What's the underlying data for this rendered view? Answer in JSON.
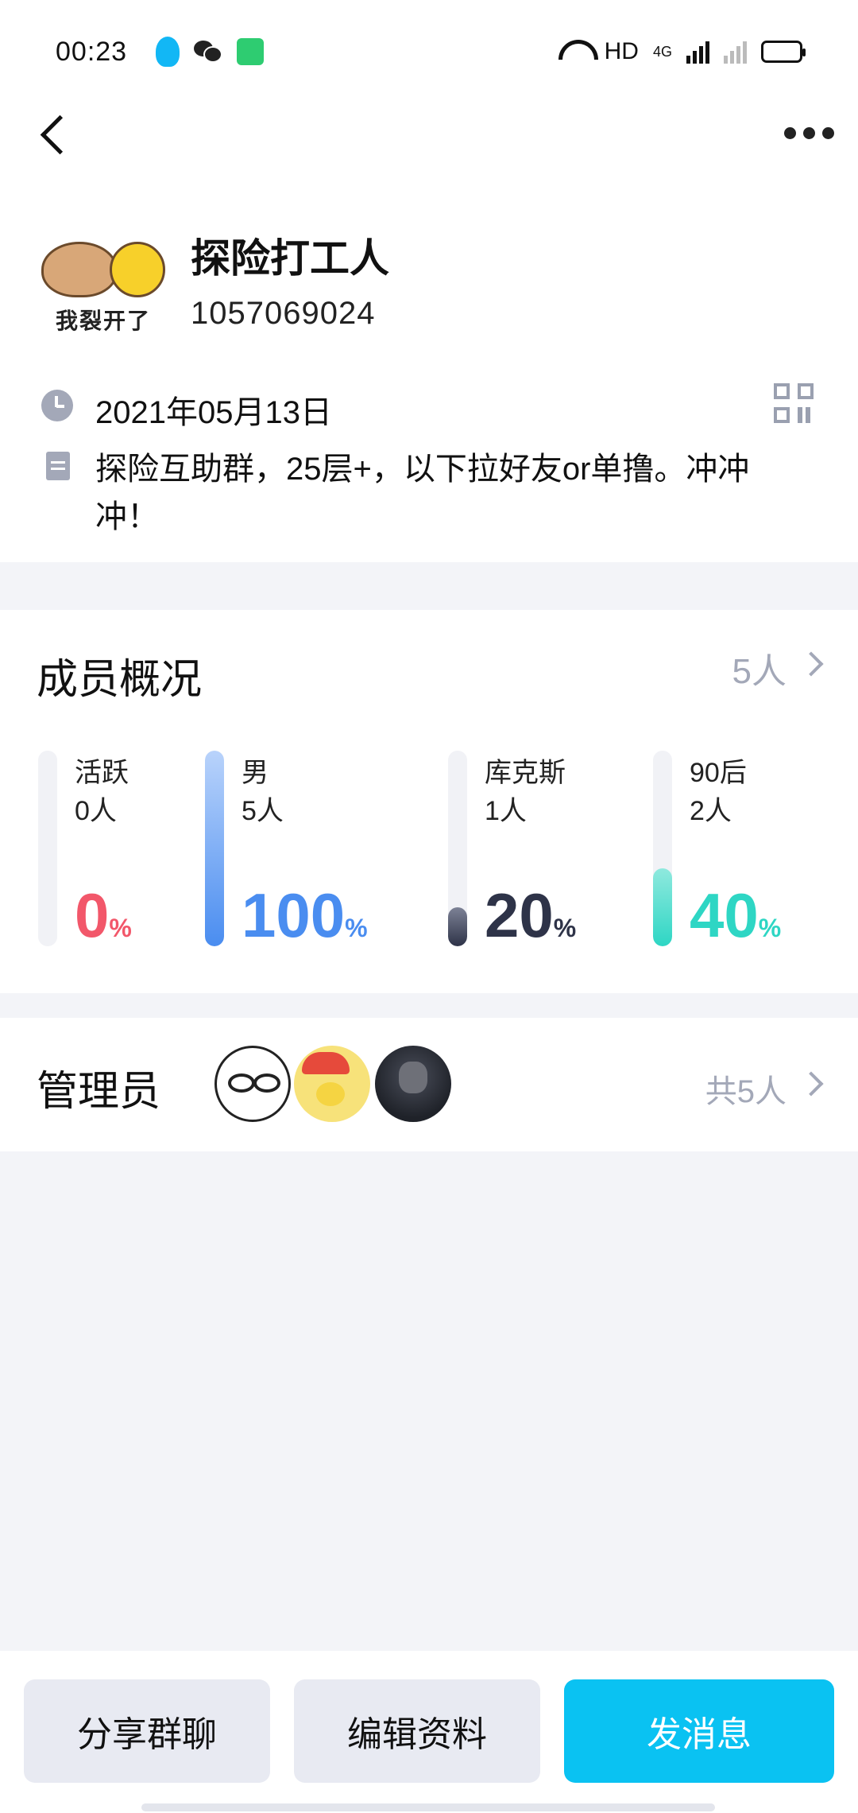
{
  "status_bar": {
    "time": "00:23",
    "network_label": "HD",
    "signal_label": "4G",
    "battery_color": "#f5c518",
    "icons": [
      "qq-icon",
      "wechat-icon",
      "battery-saver-icon",
      "wifi-icon",
      "signal-icon",
      "battery-icon"
    ]
  },
  "nav": {
    "back_icon": "chevron-left-icon",
    "more_icon": "more-horizontal-icon"
  },
  "group": {
    "avatar_caption": "我裂开了",
    "name": "探险打工人",
    "id": "1057069024",
    "created_date": "2021年05月13日",
    "description": "探险互助群，25层+，以下拉好友or单撸。冲冲冲！"
  },
  "members": {
    "title": "成员概况",
    "count": "5人",
    "stats": [
      {
        "label": "活跃",
        "people": "0人",
        "percent_value": "0",
        "percent_sign": "%",
        "fraction": 0.0,
        "color": "#f2576a"
      },
      {
        "label": "男",
        "people": "5人",
        "percent_value": "100",
        "percent_sign": "%",
        "fraction": 1.0,
        "color": "#4a8df0"
      },
      {
        "label": "库克斯",
        "people": "1人",
        "percent_value": "20",
        "percent_sign": "%",
        "fraction": 0.2,
        "color": "#2e3348"
      },
      {
        "label": "90后",
        "people": "2人",
        "percent_value": "40",
        "percent_sign": "%",
        "fraction": 0.4,
        "color": "#2ed6c4"
      }
    ]
  },
  "admins": {
    "title": "管理员",
    "count": "共5人"
  },
  "bottom_bar": {
    "share_label": "分享群聊",
    "edit_label": "编辑资料",
    "send_label": "发消息",
    "accent_color": "#0ac2f2"
  }
}
